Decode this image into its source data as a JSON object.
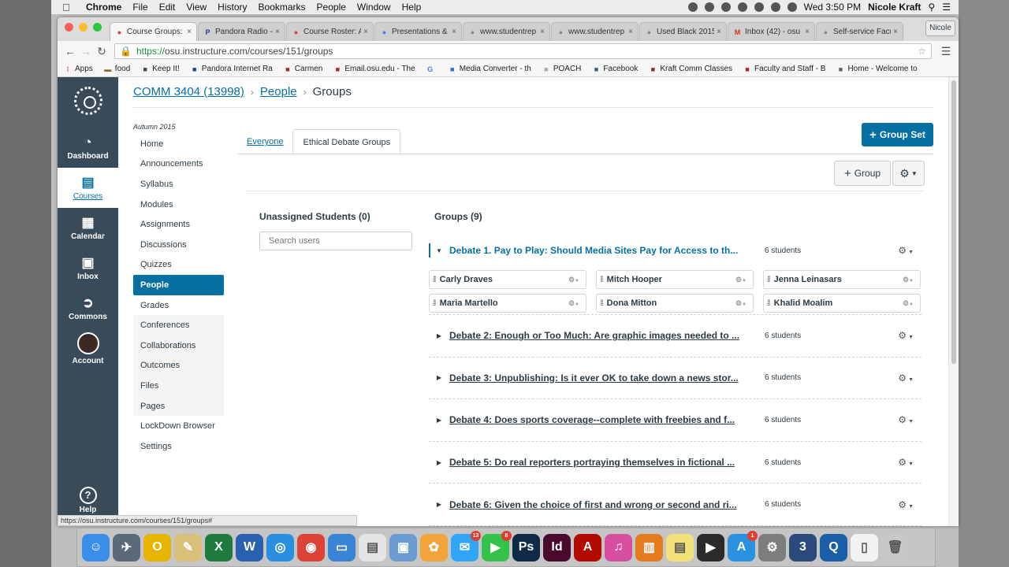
{
  "menubar": {
    "app": "Chrome",
    "items": [
      "File",
      "Edit",
      "View",
      "History",
      "Bookmarks",
      "People",
      "Window",
      "Help"
    ],
    "clock": "Wed 3:50 PM",
    "user": "Nicole Kraft"
  },
  "browser": {
    "profile": "Nicole",
    "tabs": [
      {
        "label": "Course Groups:",
        "icon": "canvas-icon",
        "color": "#e13e2b"
      },
      {
        "label": "Pandora Radio -",
        "icon": "pandora-icon",
        "color": "#224099"
      },
      {
        "label": "Course Roster: A",
        "icon": "canvas-icon",
        "color": "#e13e2b"
      },
      {
        "label": "Presentations &",
        "icon": "slides-icon",
        "color": "#3c8fd8"
      },
      {
        "label": "www.studentrep",
        "icon": "page-icon",
        "color": "#888888"
      },
      {
        "label": "www.studentrep",
        "icon": "page-icon",
        "color": "#888888"
      },
      {
        "label": "Used Black 2015",
        "icon": "page-icon",
        "color": "#888888"
      },
      {
        "label": "Inbox (42) - osu",
        "icon": "gmail-icon",
        "color": "#d93025"
      },
      {
        "label": "Self-service Facu",
        "icon": "page-icon",
        "color": "#888888"
      }
    ],
    "url_scheme": "https://",
    "url_rest": "osu.instructure.com/courses/151/groups",
    "bookmarks": [
      "Apps",
      "food",
      "Keep It!",
      "Pandora Internet Ra",
      "Carmen",
      "Email.osu.edu - The",
      "",
      "Media Converter - th",
      "POACH",
      "Facebook",
      "Kraft Comm Classes",
      "Faculty and Staff - B",
      "Home - Welcome to"
    ],
    "status_url": "https://osu.instructure.com/courses/151/groups#"
  },
  "global_nav": [
    {
      "label": "Dashboard",
      "icon": "dashboard-icon",
      "glyph": "◔"
    },
    {
      "label": "Courses",
      "icon": "courses-icon",
      "glyph": "▤"
    },
    {
      "label": "Calendar",
      "icon": "calendar-icon",
      "glyph": "▦"
    },
    {
      "label": "Inbox",
      "icon": "inbox-icon",
      "glyph": "▣"
    },
    {
      "label": "Commons",
      "icon": "commons-icon",
      "glyph": "➲"
    },
    {
      "label": "Account",
      "icon": "avatar",
      "glyph": ""
    }
  ],
  "help_label": "Help",
  "breadcrumb": {
    "course": "COMM 3404 (13998)",
    "section": "People",
    "current": "Groups"
  },
  "term": "Autumn 2015",
  "course_nav": [
    {
      "label": "Home",
      "state": ""
    },
    {
      "label": "Announcements",
      "state": ""
    },
    {
      "label": "Syllabus",
      "state": ""
    },
    {
      "label": "Modules",
      "state": ""
    },
    {
      "label": "Assignments",
      "state": ""
    },
    {
      "label": "Discussions",
      "state": ""
    },
    {
      "label": "Quizzes",
      "state": ""
    },
    {
      "label": "People",
      "state": "active"
    },
    {
      "label": "Grades",
      "state": ""
    },
    {
      "label": "Conferences",
      "state": "hidden"
    },
    {
      "label": "Collaborations",
      "state": "hidden"
    },
    {
      "label": "Outcomes",
      "state": "hidden"
    },
    {
      "label": "Files",
      "state": "hidden"
    },
    {
      "label": "Pages",
      "state": "hidden"
    },
    {
      "label": "LockDown Browser",
      "state": ""
    },
    {
      "label": "Settings",
      "state": ""
    }
  ],
  "tabs": {
    "everyone": "Everyone",
    "selected": "Ethical Debate Groups"
  },
  "buttons": {
    "group_set": "Group Set",
    "group": "Group"
  },
  "unassigned": {
    "title": "Unassigned Students (0)",
    "search_placeholder": "Search users"
  },
  "groups": {
    "title": "Groups (9)",
    "expanded_members": [
      "Carly Draves",
      "Mitch Hooper",
      "Jenna Leinasars",
      "Maria Martello",
      "Dona Mitton",
      "Khalid Moalim"
    ],
    "items": [
      {
        "name": "Debate 1. Pay to Play: Should Media Sites Pay for Access to th...",
        "count": "6 students",
        "open": true
      },
      {
        "name": "Debate 2: Enough or Too Much: Are graphic images needed to ...",
        "count": "6 students",
        "open": false
      },
      {
        "name": "Debate 3: Unpublishing: Is it ever OK to take down a news stor...",
        "count": "6 students",
        "open": false
      },
      {
        "name": "Debate 4: Does sports coverage--complete with freebies and f...",
        "count": "6 students",
        "open": false
      },
      {
        "name": "Debate 5: Do real reporters portraying themselves in fictional ...",
        "count": "6 students",
        "open": false
      },
      {
        "name": "Debate 6: Given the choice of first and wrong or second and ri...",
        "count": "6 students",
        "open": false
      }
    ]
  },
  "dock": [
    {
      "name": "finder-icon",
      "color": "#3b8ee8",
      "glyph": "☺"
    },
    {
      "name": "launchpad-icon",
      "color": "#5a6a7a",
      "glyph": "✈"
    },
    {
      "name": "outlook-icon",
      "color": "#e7b400",
      "glyph": "O"
    },
    {
      "name": "textedit-icon",
      "color": "#d9c07a",
      "glyph": "✎"
    },
    {
      "name": "excel-icon",
      "color": "#1f7a3d",
      "glyph": "X"
    },
    {
      "name": "word-icon",
      "color": "#2b5fb0",
      "glyph": "W"
    },
    {
      "name": "safari-icon",
      "color": "#2a8fe0",
      "glyph": "◎"
    },
    {
      "name": "chrome-icon",
      "color": "#db4437",
      "glyph": "◉"
    },
    {
      "name": "keynote-icon",
      "color": "#3a84d6",
      "glyph": "▭"
    },
    {
      "name": "notes-icon",
      "color": "#e4e4e4",
      "glyph": "▤"
    },
    {
      "name": "preview-icon",
      "color": "#6a9bd1",
      "glyph": "▣"
    },
    {
      "name": "photos-icon",
      "color": "#f2a33a",
      "glyph": "✿"
    },
    {
      "name": "messages-icon",
      "color": "#2ea5f5",
      "glyph": "✉",
      "badge": "13"
    },
    {
      "name": "facetime-icon",
      "color": "#34c24a",
      "glyph": "▶",
      "badge": "8"
    },
    {
      "name": "photoshop-icon",
      "color": "#0e2a47",
      "glyph": "Ps"
    },
    {
      "name": "indesign-icon",
      "color": "#4a0a2e",
      "glyph": "Id"
    },
    {
      "name": "acrobat-icon",
      "color": "#b30b00",
      "glyph": "A"
    },
    {
      "name": "itunes-icon",
      "color": "#d94fa0",
      "glyph": "♫"
    },
    {
      "name": "ibooks-icon",
      "color": "#e67a1e",
      "glyph": "▥"
    },
    {
      "name": "stickies-icon",
      "color": "#f3e27a",
      "glyph": "▤"
    },
    {
      "name": "finalcut-icon",
      "color": "#2b2b2b",
      "glyph": "▶"
    },
    {
      "name": "appstore-icon",
      "color": "#2a90e0",
      "glyph": "A",
      "badge": "1"
    },
    {
      "name": "sysprefs-icon",
      "color": "#7d7d7d",
      "glyph": "⚙"
    },
    {
      "name": "timemachine-icon",
      "color": "#2a4a7a",
      "glyph": "3"
    },
    {
      "name": "quicktime-icon",
      "color": "#1c5fa8",
      "glyph": "Q"
    },
    {
      "name": "document-icon",
      "color": "#f2f2f2",
      "glyph": "▯"
    },
    {
      "name": "trash-icon",
      "color": "#c8c8c8",
      "glyph": "🗑"
    }
  ]
}
